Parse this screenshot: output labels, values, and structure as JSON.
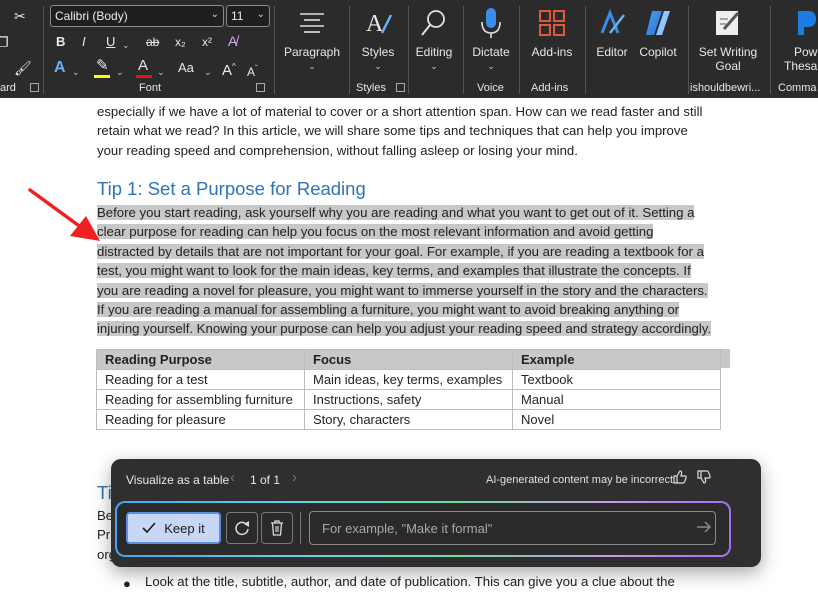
{
  "ribbon": {
    "clipboard_label": "ard",
    "font": {
      "name": "Calibri (Body)",
      "size": "11",
      "label": "Font",
      "bold": "B",
      "italic": "I",
      "underline": "U",
      "strikethrough": "ab",
      "subscript": "x₂",
      "superscript": "x²",
      "case": "Aa",
      "grow": "A",
      "shrink": "A"
    },
    "paragraph": {
      "label": "Paragraph"
    },
    "styles": {
      "label": "Styles",
      "group_label": "Styles"
    },
    "editing": {
      "label": "Editing"
    },
    "dictate": {
      "label": "Dictate",
      "group_label": "Voice"
    },
    "addins": {
      "label": "Add-ins",
      "group_label": "Add-ins"
    },
    "editor": {
      "label": "Editor"
    },
    "copilot": {
      "label": "Copilot"
    },
    "writing_goal": {
      "label_line1": "Set Writing",
      "label_line2": "Goal",
      "group_label": "ishouldbewri..."
    },
    "thesaurus": {
      "label_line1": "Powe",
      "label_line2": "Thesau",
      "group_label": "Comma"
    },
    "colors": {
      "accent": "#2e74b5",
      "highlight": "#ffff00",
      "font_color": "#e81123"
    }
  },
  "document": {
    "intro_lines": [
      "especially if we have a lot of material to cover or a short attention span. How can we read faster and still",
      "retain what we read? In this article, we will share some tips and techniques that can help you improve",
      "your reading speed and comprehension, without falling asleep or losing your mind."
    ],
    "tip1_heading": "Tip 1: Set a Purpose for Reading",
    "tip1_lines": [
      "Before you start reading, ask yourself why you are reading and what you want to get out of it. Setting a",
      "clear purpose for reading can help you focus on the most relevant information and avoid getting",
      "distracted by details that are not important for your goal. For example, if you are reading a textbook for a",
      "test, you might want to look for the main ideas, key terms, and examples that illustrate the concepts. If",
      "you are reading a novel for pleasure, you might want to immerse yourself in the story and the characters.",
      "If you are reading a manual for assembling a furniture, you might want to avoid breaking anything or",
      "injuring yourself. Knowing your purpose can help you adjust your reading speed and strategy accordingly."
    ],
    "table": {
      "headers": [
        "Reading Purpose",
        "Focus",
        "Example"
      ],
      "rows": [
        [
          "Reading for a test",
          "Main ideas, key terms, examples",
          "Textbook"
        ],
        [
          "Reading for assembling furniture",
          "Instructions, safety",
          "Manual"
        ],
        [
          "Reading for pleasure",
          "Story, characters",
          "Novel"
        ]
      ]
    },
    "tip2_heading_partial": "Ti",
    "tip2_lines_partial": [
      "Be",
      "Pr",
      "org"
    ],
    "bullet_text": "Look at the title, subtitle, author, and date of publication. This can give you a clue about the"
  },
  "copilot_panel": {
    "title": "Visualize as a table",
    "page": "1 of 1",
    "warning": "AI-generated content may be incorrect",
    "keep_label": "Keep it",
    "prompt_placeholder": "For example, \"Make it formal\""
  }
}
